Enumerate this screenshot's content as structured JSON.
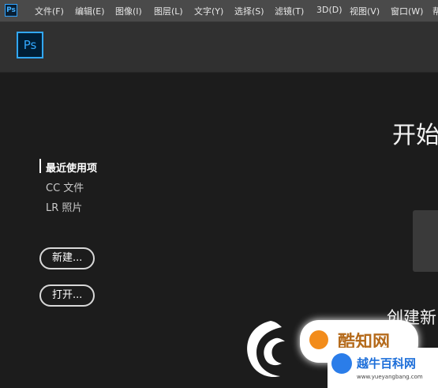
{
  "menubar": {
    "app_icon": "Ps",
    "items": [
      "文件(F)",
      "编辑(E)",
      "图像(I)",
      "图层(L)",
      "文字(Y)",
      "选择(S)",
      "滤镜(T)",
      "3D(D)",
      "视图(V)",
      "窗口(W)",
      "帮"
    ]
  },
  "header": {
    "logo": "Ps"
  },
  "sidebar": {
    "items": [
      {
        "label": "最近使用项",
        "active": true
      },
      {
        "label": "CC 文件",
        "active": false
      },
      {
        "label": "LR 照片",
        "active": false
      }
    ],
    "new_button": "新建...",
    "open_button": "打开..."
  },
  "main": {
    "start_title": "开始",
    "create_title": "创建新"
  },
  "watermark": {
    "badge_text": "酷知网",
    "corner_title": "越牛百科网",
    "corner_url": "www.yueyangbang.com"
  },
  "colors": {
    "accent": "#31a8ff",
    "background": "#1c1c1c",
    "menubar": "#4a4a4a",
    "header": "#303030"
  }
}
